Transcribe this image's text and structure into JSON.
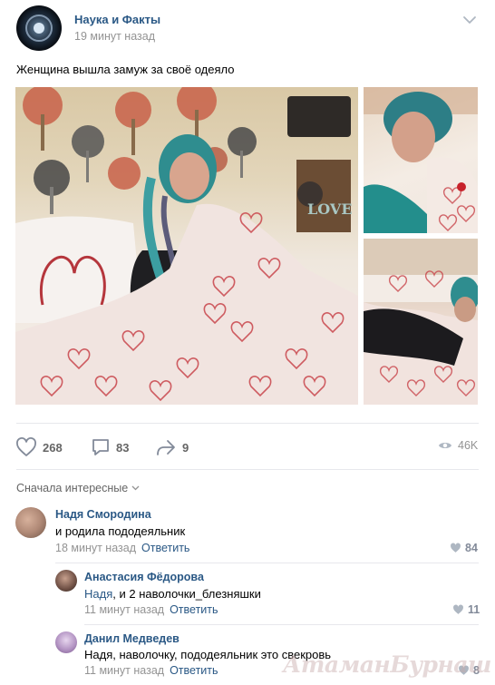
{
  "post": {
    "group_name": "Наука и Факты",
    "time": "19 минут назад",
    "text": "Женщина вышла замуж за своё одеяло"
  },
  "actions": {
    "likes": "268",
    "comments": "83",
    "shares": "9",
    "views": "46K"
  },
  "comments_sort": "Сначала интересные",
  "comments": [
    {
      "name": "Надя Смородина",
      "text": "и родила пододеяльник",
      "time": "18 минут назад",
      "reply": "Ответить",
      "likes": "84"
    },
    {
      "name": "Анастасия Фёдорова",
      "mention": "Надя",
      "text": ", и 2 наволочки_блезняшки",
      "time": "11 минут назад",
      "reply": "Ответить",
      "likes": "11"
    },
    {
      "name": "Данил Медведев",
      "text": "Надя, наволочку, пододеяльник это свекровь",
      "time": "11 минут назад",
      "reply": "Ответить",
      "likes": "8"
    }
  ],
  "watermark": "АтаманБурнаш для ДП",
  "colors": {
    "link": "#2a5885",
    "muted": "#939393",
    "icon": "#828a99"
  }
}
